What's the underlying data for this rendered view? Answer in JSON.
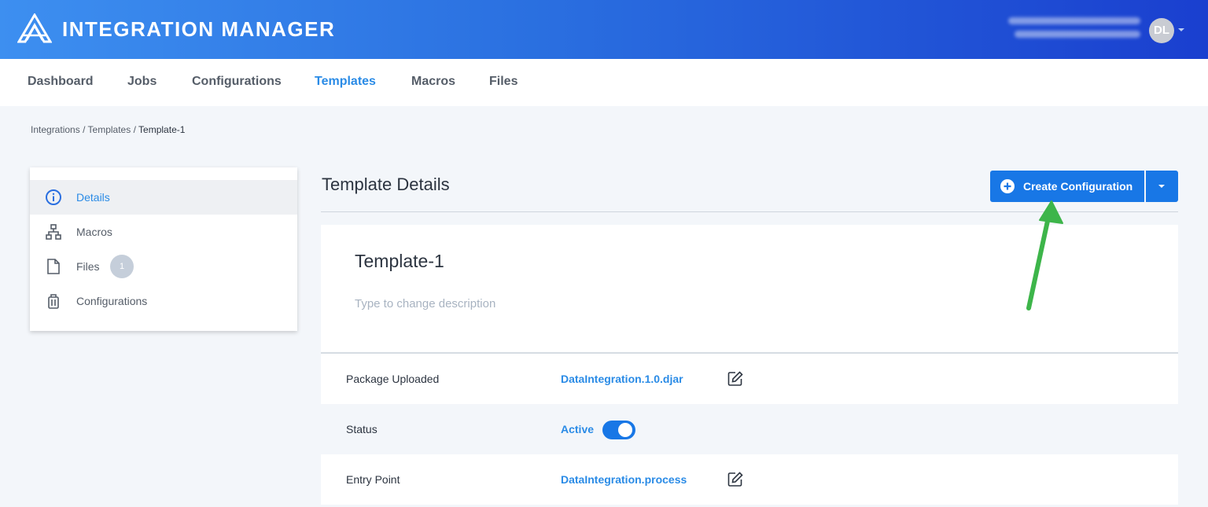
{
  "app": {
    "title": "INTEGRATION MANAGER",
    "user_initials": "DL"
  },
  "nav": {
    "items": [
      {
        "label": "Dashboard"
      },
      {
        "label": "Jobs"
      },
      {
        "label": "Configurations"
      },
      {
        "label": "Templates",
        "active": true
      },
      {
        "label": "Macros"
      },
      {
        "label": "Files"
      }
    ]
  },
  "breadcrumb": {
    "items": [
      "Integrations",
      "Templates"
    ],
    "current": "Template-1",
    "separator": "/"
  },
  "sidebar": {
    "items": [
      {
        "label": "Details",
        "icon": "info-icon",
        "active": true
      },
      {
        "label": "Macros",
        "icon": "sitemap-icon"
      },
      {
        "label": "Files",
        "icon": "file-icon",
        "badge": "1"
      },
      {
        "label": "Configurations",
        "icon": "luggage-icon"
      }
    ]
  },
  "main": {
    "title": "Template Details",
    "create_button": "Create Configuration",
    "template_name": "Template-1",
    "description_placeholder": "Type to change description",
    "rows": [
      {
        "label": "Package Uploaded",
        "value": "DataIntegration.1.0.djar"
      },
      {
        "label": "Status",
        "value": "Active",
        "toggle_on": true
      },
      {
        "label": "Entry Point",
        "value": "DataIntegration.process"
      }
    ]
  },
  "colors": {
    "accent": "#1877e6",
    "link": "#2a8be6",
    "annotation_arrow": "#3db54a"
  }
}
